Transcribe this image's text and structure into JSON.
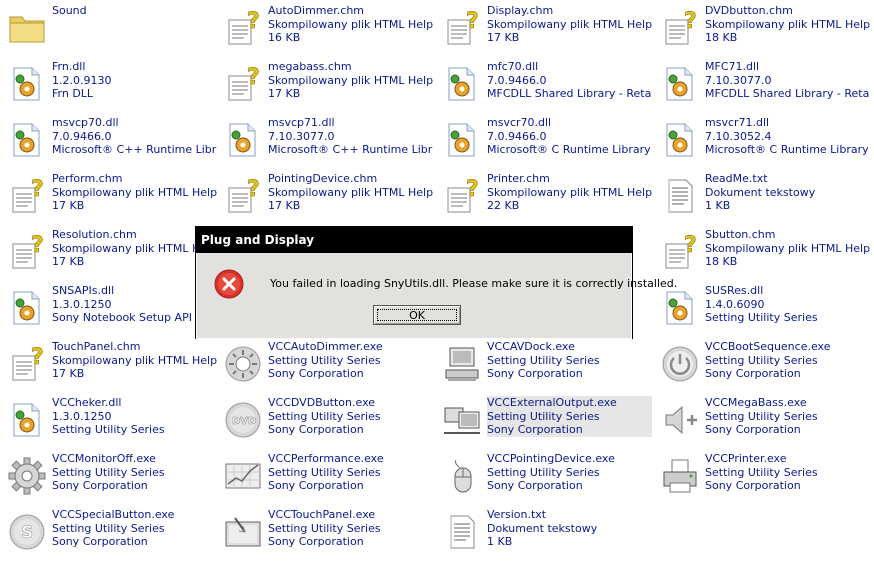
{
  "files": [
    {
      "name": "Sound",
      "line2": "",
      "line3": "",
      "icon": "folder-icon"
    },
    {
      "name": "AutoDimmer.chm",
      "line2": "Skompilowany plik HTML Help",
      "line3": "16 KB",
      "icon": "help-file-icon"
    },
    {
      "name": "Display.chm",
      "line2": "Skompilowany plik HTML Help",
      "line3": "17 KB",
      "icon": "help-file-icon"
    },
    {
      "name": "DVDbutton.chm",
      "line2": "Skompilowany plik HTML Help",
      "line3": "18 KB",
      "icon": "help-file-icon"
    },
    {
      "name": "Frn.dll",
      "line2": "1.2.0.9130",
      "line3": "Frn DLL",
      "icon": "dll-icon"
    },
    {
      "name": "megabass.chm",
      "line2": "Skompilowany plik HTML Help",
      "line3": "17 KB",
      "icon": "help-file-icon"
    },
    {
      "name": "mfc70.dll",
      "line2": "7.0.9466.0",
      "line3": "MFCDLL Shared Library - Retail V...",
      "icon": "dll-icon"
    },
    {
      "name": "MFC71.dll",
      "line2": "7.10.3077.0",
      "line3": "MFCDLL Shared Library - Retail V...",
      "icon": "dll-icon"
    },
    {
      "name": "msvcp70.dll",
      "line2": "7.0.9466.0",
      "line3": "Microsoft® C++ Runtime Library",
      "icon": "dll-icon"
    },
    {
      "name": "msvcp71.dll",
      "line2": "7.10.3077.0",
      "line3": "Microsoft® C++ Runtime Library",
      "icon": "dll-icon"
    },
    {
      "name": "msvcr70.dll",
      "line2": "7.0.9466.0",
      "line3": "Microsoft® C Runtime Library",
      "icon": "dll-icon"
    },
    {
      "name": "msvcr71.dll",
      "line2": "7.10.3052.4",
      "line3": "Microsoft® C Runtime Library",
      "icon": "dll-icon"
    },
    {
      "name": "Perform.chm",
      "line2": "Skompilowany plik HTML Help",
      "line3": "17 KB",
      "icon": "help-file-icon"
    },
    {
      "name": "PointingDevice.chm",
      "line2": "Skompilowany plik HTML Help",
      "line3": "17 KB",
      "icon": "help-file-icon"
    },
    {
      "name": "Printer.chm",
      "line2": "Skompilowany plik HTML Help",
      "line3": "22 KB",
      "icon": "help-file-icon"
    },
    {
      "name": "ReadMe.txt",
      "line2": "Dokument tekstowy",
      "line3": "1 KB",
      "icon": "text-file-icon"
    },
    {
      "name": "Resolution.chm",
      "line2": "Skompilowany plik HTML Help",
      "line3": "17 KB",
      "icon": "help-file-icon"
    },
    {
      "name": "",
      "line2": "",
      "line3": "",
      "icon": ""
    },
    {
      "name": "",
      "line2": "",
      "line3": "",
      "icon": ""
    },
    {
      "name": "Sbutton.chm",
      "line2": "Skompilowany plik HTML Help",
      "line3": "18 KB",
      "icon": "help-file-icon"
    },
    {
      "name": "SNSAPIs.dll",
      "line2": "1.3.0.1250",
      "line3": "Sony Notebook Setup API Library",
      "icon": "dll-icon"
    },
    {
      "name": "",
      "line2": "",
      "line3": "",
      "icon": ""
    },
    {
      "name": "",
      "line2": "",
      "line3": "",
      "icon": ""
    },
    {
      "name": "SUSRes.dll",
      "line2": "1.4.0.6090",
      "line3": "Setting Utility Series",
      "icon": "dll-icon"
    },
    {
      "name": "TouchPanel.chm",
      "line2": "Skompilowany plik HTML Help",
      "line3": "17 KB",
      "icon": "help-file-icon"
    },
    {
      "name": "VCCAutoDimmer.exe",
      "line2": "Setting Utility Series",
      "line3": "Sony Corporation",
      "icon": "brightness-icon"
    },
    {
      "name": "VCCAVDock.exe",
      "line2": "Setting Utility Series",
      "line3": "Sony Corporation",
      "icon": "av-dock-icon"
    },
    {
      "name": "VCCBootSequence.exe",
      "line2": "Setting Utility Series",
      "line3": "Sony Corporation",
      "icon": "power-icon"
    },
    {
      "name": "VCCheker.dll",
      "line2": "1.3.0.1250",
      "line3": "Setting Utility Series",
      "icon": "dll-icon"
    },
    {
      "name": "VCCDVDButton.exe",
      "line2": "Setting Utility Series",
      "line3": "Sony Corporation",
      "icon": "dvd-icon"
    },
    {
      "name": "VCCExternalOutput.exe",
      "line2": "Setting Utility Series",
      "line3": "Sony Corporation",
      "icon": "monitors-icon"
    },
    {
      "name": "VCCMegaBass.exe",
      "line2": "Setting Utility Series",
      "line3": "Sony Corporation",
      "icon": "speaker-icon"
    },
    {
      "name": "VCCMonitorOff.exe",
      "line2": "Setting Utility Series",
      "line3": "Sony Corporation",
      "icon": "gear-icon"
    },
    {
      "name": "VCCPerformance.exe",
      "line2": "Setting Utility Series",
      "line3": "Sony Corporation",
      "icon": "performance-icon"
    },
    {
      "name": "VCCPointingDevice.exe",
      "line2": "Setting Utility Series",
      "line3": "Sony Corporation",
      "icon": "mouse-icon"
    },
    {
      "name": "VCCPrinter.exe",
      "line2": "Setting Utility Series",
      "line3": "Sony Corporation",
      "icon": "printer-icon"
    },
    {
      "name": "VCCSpecialButton.exe",
      "line2": "Setting Utility Series",
      "line3": "Sony Corporation",
      "icon": "s-button-icon"
    },
    {
      "name": "VCCTouchPanel.exe",
      "line2": "Setting Utility Series",
      "line3": "Sony Corporation",
      "icon": "touch-panel-icon"
    },
    {
      "name": "Version.txt",
      "line2": "Dokument tekstowy",
      "line3": "1 KB",
      "icon": "text-file-icon"
    }
  ],
  "selected_index": 30,
  "dialog": {
    "title": "Plug and Display",
    "message": "You failed in loading SnyUtils.dll. Please make sure it is correctly installed.",
    "ok_label": "OK",
    "icon": "error-icon"
  },
  "colors": {
    "text": "#0a1a8a",
    "dialog_bg": "#e2e1de",
    "error_red": "#d9302a"
  }
}
